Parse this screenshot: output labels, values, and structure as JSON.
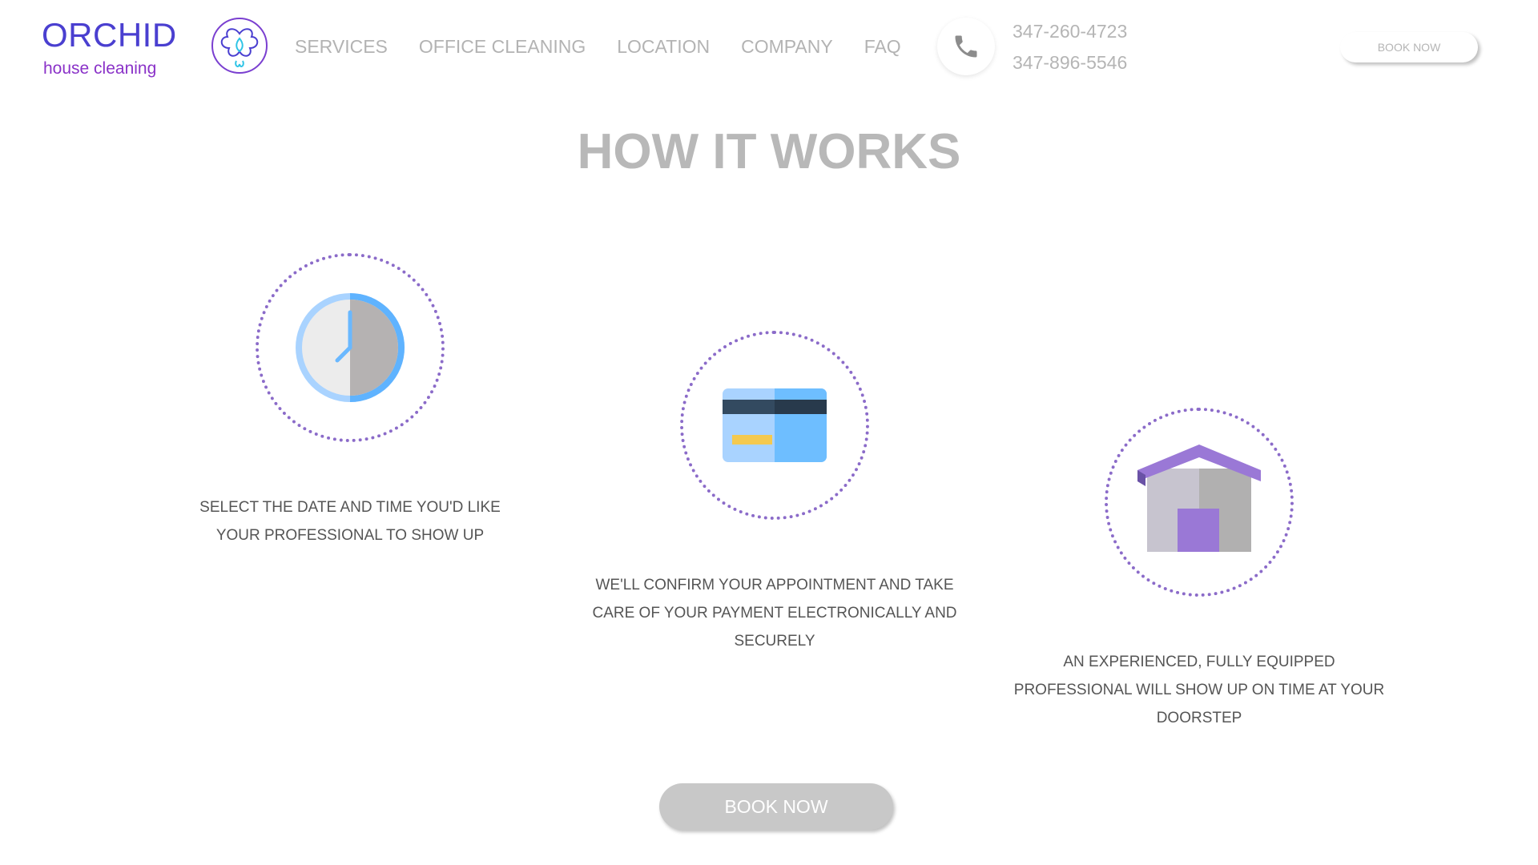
{
  "header": {
    "logo": {
      "word": "ORCHID",
      "tagline": "house cleaning",
      "colors": {
        "primary": "#4a3fd0",
        "secondary": "#8a32c8",
        "accent": "#2ec4e6"
      }
    },
    "nav": [
      {
        "label": "SERVICES"
      },
      {
        "label": "OFFICE CLEANING"
      },
      {
        "label": "LOCATION"
      },
      {
        "label": "COMPANY"
      },
      {
        "label": "FAQ"
      }
    ],
    "phone": {
      "icon": "phone-icon",
      "numbers": [
        "347-260-4723",
        "347-896-5546"
      ]
    },
    "book_button": "BOOK NOW"
  },
  "main": {
    "title": "HOW IT WORKS",
    "steps": [
      {
        "icon": "clock-icon",
        "text": "SELECT THE DATE AND TIME YOU'D LIKE YOUR PROFESSIONAL TO SHOW UP"
      },
      {
        "icon": "credit-card-icon",
        "text": "WE'LL CONFIRM YOUR APPOINTMENT AND TAKE CARE OF YOUR PAYMENT ELECTRONICALLY AND SECURELY"
      },
      {
        "icon": "house-icon",
        "text": "AN EXPERIENCED, FULLY EQUIPPED PROFESSIONAL WILL SHOW UP ON TIME AT YOUR DOORSTEP"
      }
    ],
    "book_button": "BOOK NOW"
  },
  "colors": {
    "dotted_circle": "#8b6bc9",
    "muted_text": "#b5b5b5",
    "body_text": "#555555",
    "button_gray": "#c8c8c8"
  }
}
